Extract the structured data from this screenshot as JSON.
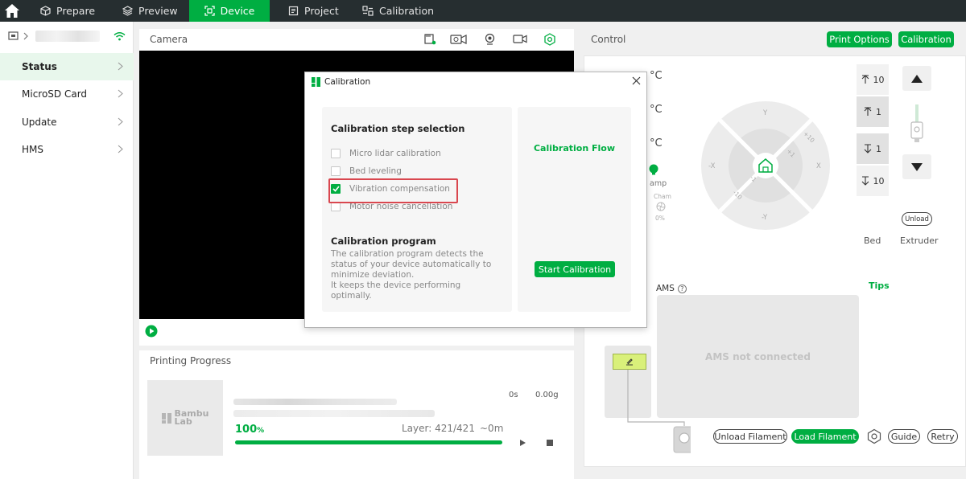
{
  "nav": {
    "tabs": [
      {
        "label": "Prepare",
        "icon": "cube-icon"
      },
      {
        "label": "Preview",
        "icon": "layers-icon"
      },
      {
        "label": "Device",
        "icon": "device-icon"
      },
      {
        "label": "Project",
        "icon": "project-icon"
      },
      {
        "label": "Calibration",
        "icon": "calibration-icon"
      }
    ],
    "active_tab": "Device"
  },
  "sidebar": {
    "items": [
      {
        "label": "Status"
      },
      {
        "label": "MicroSD Card"
      },
      {
        "label": "Update"
      },
      {
        "label": "HMS"
      }
    ],
    "active_item": "Status"
  },
  "camera": {
    "title": "Camera"
  },
  "progress": {
    "title": "Printing Progress",
    "thumb_logo_line1": "Bambu",
    "thumb_logo_line2": "Lab",
    "time": "0s",
    "weight": "0.00g",
    "percent_value": "100",
    "percent_unit": "%",
    "percent_fraction": 1.0,
    "layer": "Layer: 421/421",
    "remaining": "~0m"
  },
  "control": {
    "title": "Control",
    "print_options_label": "Print Options",
    "calibration_label": "Calibration",
    "temp_unit": "°C",
    "lamp_fragment": "amp",
    "chamber_fragment": "Cham",
    "fan_fragment": "0%",
    "jog": {
      "y_plus": "Y",
      "y_minus": "-Y",
      "x_plus": "X",
      "x_minus": "-X",
      "plus_10": "+10",
      "plus_1": "+1",
      "minus_1": "-1",
      "minus_10": "-10"
    },
    "bed_steps": [
      "10",
      "1",
      "1",
      "10"
    ],
    "unload_small": "Unload",
    "bed_label": "Bed",
    "extruder_label": "Extruder",
    "ams_label": "AMS",
    "ams_help": "?",
    "tips_label": "Tips",
    "ams_status": "AMS not connected",
    "unload_filament_label": "Unload Filament",
    "load_filament_label": "Load Filament",
    "guide_label": "Guide",
    "retry_label": "Retry",
    "colors": {
      "accent": "#00ae42"
    }
  },
  "dialog": {
    "title": "Calibration",
    "step_selection_title": "Calibration step selection",
    "steps": [
      {
        "label": "Micro lidar calibration",
        "checked": false
      },
      {
        "label": "Bed leveling",
        "checked": false
      },
      {
        "label": "Vibration compensation",
        "checked": true
      },
      {
        "label": "Motor noise cancellation",
        "checked": false
      }
    ],
    "program_title": "Calibration program",
    "program_desc_1": "The calibration program detects the status of your device automatically to minimize deviation.",
    "program_desc_2": "It keeps the device performing optimally.",
    "flow_title": "Calibration Flow",
    "start_label": "Start Calibration"
  }
}
